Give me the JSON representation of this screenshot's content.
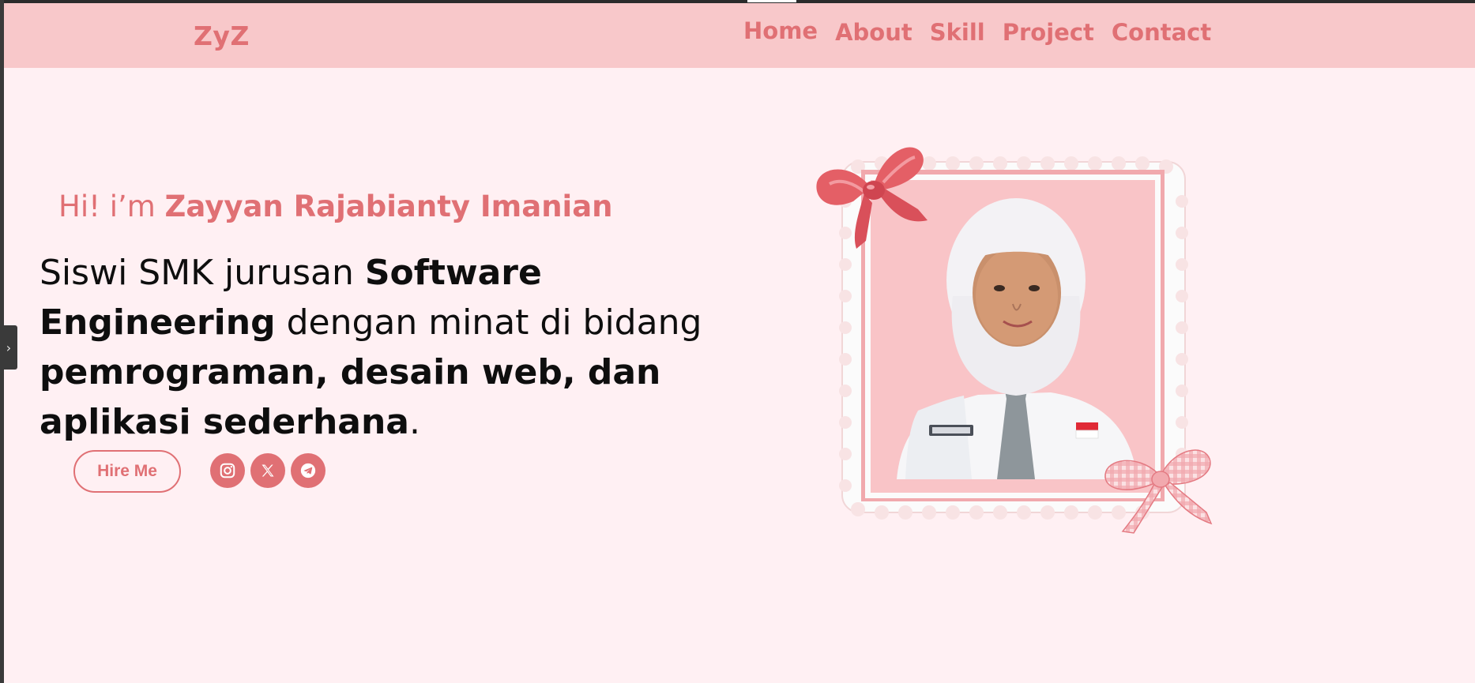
{
  "header": {
    "logo": "ZyZ",
    "nav": [
      "Home",
      "About",
      "Skill",
      "Project",
      "Contact"
    ]
  },
  "hero": {
    "greeting_prefix": "Hi! i’m ",
    "greeting_name": "Zayyan Rajabianty Imanian",
    "desc_1": "Siswi SMK jurusan ",
    "desc_2": "Software Engineering",
    "desc_3": " dengan minat di bidang ",
    "desc_4": "pemrograman, desain web, dan aplikasi sederhana",
    "desc_5": ".",
    "hire_label": "Hire Me"
  },
  "social_icons": [
    "instagram-icon",
    "x-icon",
    "telegram-icon"
  ],
  "colors": {
    "accent": "#e07074",
    "navbar_bg": "#f8c8ca",
    "page_bg": "#fff0f3",
    "text": "#0e0e0e"
  }
}
